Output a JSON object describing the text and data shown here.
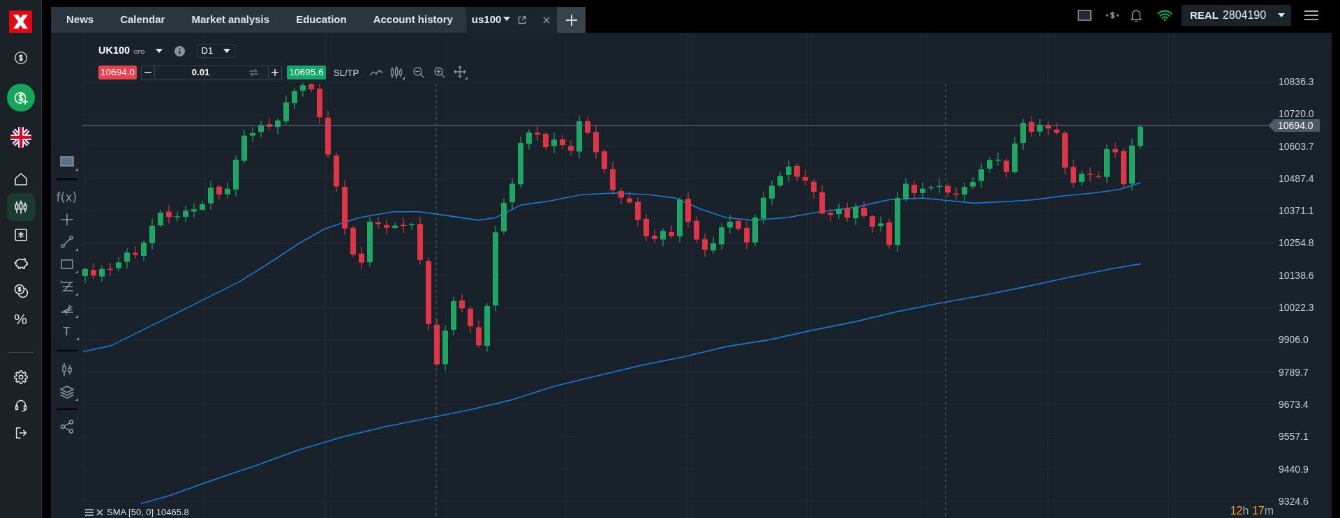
{
  "sidebar": {
    "nav": [
      {
        "selected": false
      },
      {
        "selected": true
      },
      {
        "selected": false
      },
      {
        "selected": false
      },
      {
        "selected": false
      },
      {
        "selected": false,
        "glyph": "%"
      }
    ]
  },
  "tabs": [
    {
      "label": "News",
      "kind": "section",
      "selected": false
    },
    {
      "label": "Calendar",
      "kind": "section",
      "selected": false
    },
    {
      "label": "Market analysis",
      "kind": "section",
      "selected": false
    },
    {
      "label": "Education",
      "kind": "section",
      "selected": false
    },
    {
      "label": "Account history",
      "kind": "section",
      "selected": false
    },
    {
      "label": "us100",
      "kind": "instrument",
      "selected": true
    }
  ],
  "account": {
    "type": "REAL",
    "number": "2804190"
  },
  "instrument": {
    "symbol": "UK100",
    "type": "CFD",
    "timeframe": "D1"
  },
  "order": {
    "sell_price": "10694.0",
    "volume": "0.01",
    "buy_price": "10695.6",
    "sl_tp": "SL/TP"
  },
  "chart_tools": {
    "indicators": "f(x)",
    "text": "T"
  },
  "chart": {
    "price_axis": [
      "10836.3",
      "10720.0",
      "10603.7",
      "10487.4",
      "10371.1",
      "10254.8",
      "10138.6",
      "10022.3",
      "9906.0",
      "9789.7",
      "9673.4",
      "9557.1",
      "9440.9",
      "9324.6"
    ],
    "current_price": "10694.0",
    "indicator_legend": "SMA [50, 0] 10465.8",
    "countdown": [
      {
        "value": "12",
        "unit": "h"
      },
      {
        "value": "17",
        "unit": "m"
      }
    ]
  }
}
